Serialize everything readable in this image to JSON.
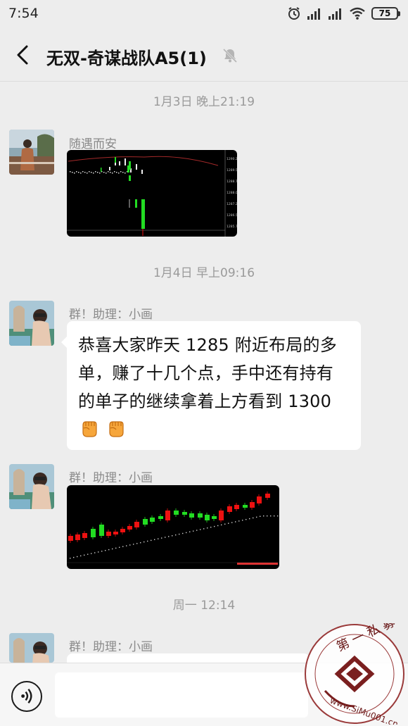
{
  "status_bar": {
    "time": "7:54",
    "battery": "75"
  },
  "header": {
    "title": "无双-奇谋战队A5(1)"
  },
  "messages": [
    {
      "timestamp": "1月3日 晚上21:19",
      "sender": "随遇而安",
      "type": "image",
      "chart_axis_labels": [
        "1290.25",
        "1289.50",
        "1288.75",
        "1288.00",
        "1287.25",
        "1286.50",
        "1285.75"
      ]
    },
    {
      "timestamp": "1月4日 早上09:16",
      "sender": "群！助理：小画",
      "type": "text",
      "lines": [
        "恭喜大家昨天 1285 附近布局的多",
        "单，赚了十几个点，手中还有持有",
        "的单子的继续拿着上方看到 1300"
      ]
    },
    {
      "sender": "群！助理：小画",
      "type": "image"
    },
    {
      "timestamp": "周一 12:14",
      "sender": "群！助理：小画",
      "type": "text"
    }
  ],
  "watermark": {
    "text": "第一私募 www.SiMu001.cn"
  },
  "colors": {
    "background": "#ededed",
    "bubble": "#ffffff",
    "candle_up": "#22dd22",
    "candle_down": "#ee1111"
  }
}
